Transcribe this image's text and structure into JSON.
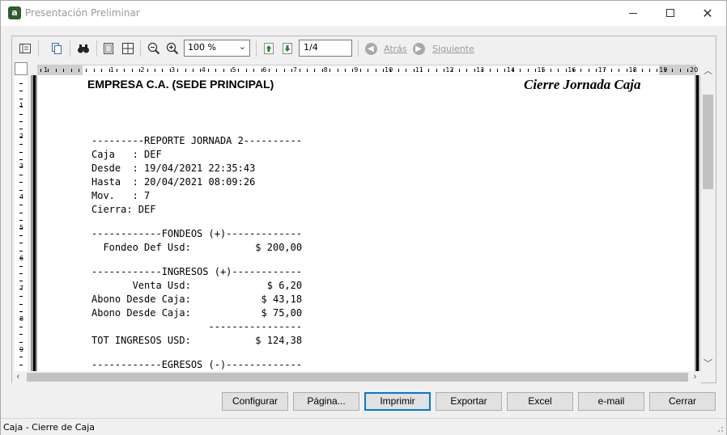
{
  "window": {
    "title": "Presentación Preliminar",
    "icon": "app-icon",
    "controls": [
      "minimize-icon",
      "maximize-icon",
      "close-icon"
    ]
  },
  "toolbar": {
    "zoom_value": "100 %",
    "page_value": "1/4",
    "back_label": "Atrás",
    "next_label": "Siguiente",
    "icons": [
      "outline-icon",
      "copy-pages-icon",
      "find-binoculars-icon",
      "single-page-icon",
      "multi-page-icon",
      "zoom-out-icon",
      "zoom-in-icon",
      "first-page-icon",
      "next-page-icon",
      "back-arrow-icon",
      "forward-arrow-icon"
    ]
  },
  "ruler": {
    "h_labels": [
      "1",
      "1",
      "2",
      "3",
      "4",
      "5",
      "6",
      "7",
      "8",
      "9",
      "10",
      "11",
      "12",
      "13",
      "14",
      "15",
      "16",
      "17",
      "18",
      "19",
      "20"
    ],
    "v_labels": [
      "1",
      "2",
      "3",
      "4",
      "5",
      "6",
      "7",
      "8",
      "9"
    ]
  },
  "report": {
    "company": "EMPRESA C.A. (SEDE PRINCIPAL)",
    "title": "Cierre Jornada Caja",
    "lines": [
      "---------REPORTE JORNADA 2----------",
      "Caja   : DEF",
      "Desde  : 19/04/2021 22:35:43",
      "Hasta  : 20/04/2021 08:09:26",
      "Mov.   : 7",
      "Cierra: DEF",
      "",
      "------------FONDEOS (+)-------------",
      "  Fondeo Def Usd:           $ 200,00",
      "",
      "------------INGRESOS (+)------------",
      "       Venta Usd:             $ 6,20",
      "Abono Desde Caja:            $ 43,18",
      "Abono Desde Caja:            $ 75,00",
      "                    ----------------",
      "TOT INGRESOS USD:           $ 124,38",
      "",
      "------------EGRESOS (-)-------------"
    ]
  },
  "buttons": {
    "configurar": "Configurar",
    "pagina": "Página...",
    "imprimir": "Imprimir",
    "exportar": "Exportar",
    "excel": "Excel",
    "email": "e-mail",
    "cerrar": "Cerrar"
  },
  "status": {
    "text": "Caja - Cierre de Caja"
  }
}
